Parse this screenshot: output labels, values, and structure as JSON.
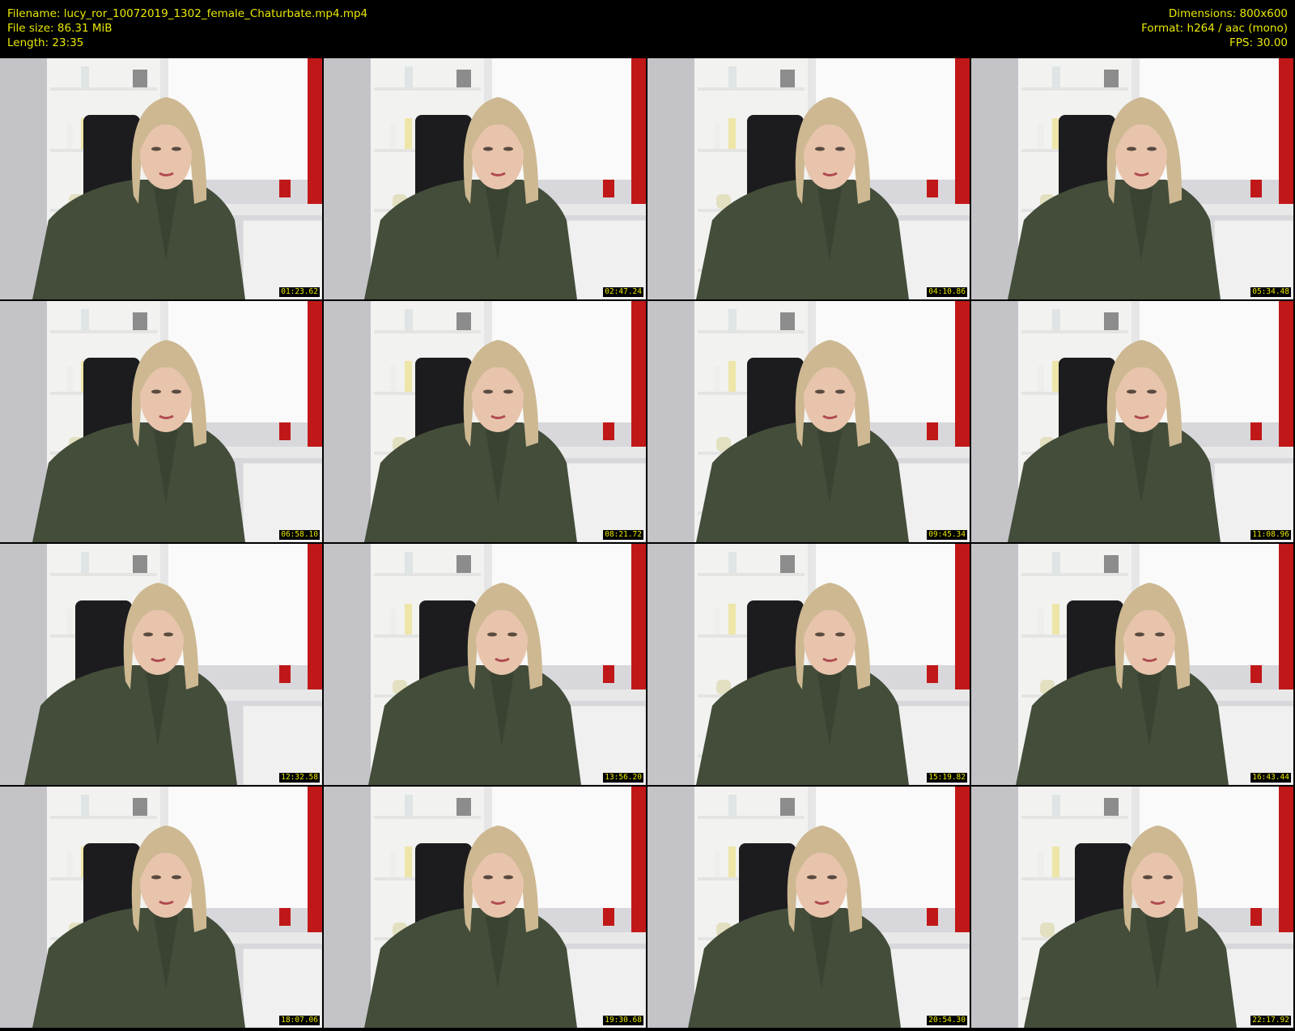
{
  "header": {
    "filename": "Filename: lucy_ror_10072019_1302_female_Chaturbate.mp4.mp4",
    "filesize": "File size: 86.31 MiB",
    "length": "Length: 23:35",
    "dimensions": "Dimensions: 800x600",
    "format": "Format: h264 / aac (mono)",
    "fps": "FPS: 30.00"
  },
  "colors": {
    "text": "#e8e800",
    "background": "#000000",
    "shirt": "#434d3a",
    "hair": "#cdb892",
    "wall": "#d8d8dc",
    "accent_red": "#c01818"
  },
  "thumbnails": [
    {
      "timestamp": "01:23.62"
    },
    {
      "timestamp": "02:47.24"
    },
    {
      "timestamp": "04:10.86"
    },
    {
      "timestamp": "05:34.48"
    },
    {
      "timestamp": "06:58.10"
    },
    {
      "timestamp": "08:21.72"
    },
    {
      "timestamp": "09:45.34"
    },
    {
      "timestamp": "11:08.96"
    },
    {
      "timestamp": "12:32.58"
    },
    {
      "timestamp": "13:56.20"
    },
    {
      "timestamp": "15:19.82"
    },
    {
      "timestamp": "16:43.44"
    },
    {
      "timestamp": "18:07.06"
    },
    {
      "timestamp": "19:30.68"
    },
    {
      "timestamp": "20:54.30"
    },
    {
      "timestamp": "22:17.92"
    }
  ]
}
